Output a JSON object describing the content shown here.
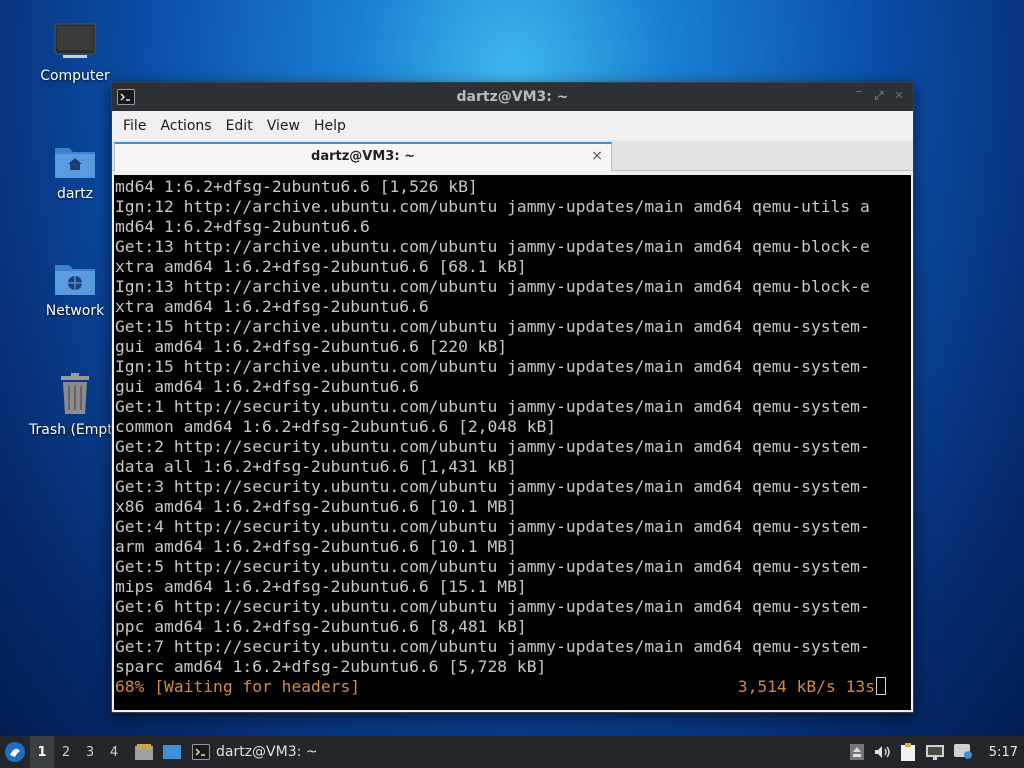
{
  "desktop": {
    "icons": [
      {
        "label": "Computer"
      },
      {
        "label": "dartz"
      },
      {
        "label": "Network"
      },
      {
        "label": "Trash (Empty)"
      }
    ]
  },
  "window": {
    "title": "dartz@VM3: ~",
    "menu": [
      "File",
      "Actions",
      "Edit",
      "View",
      "Help"
    ],
    "tab_label": "dartz@VM3: ~",
    "tab_close": "×"
  },
  "terminal": {
    "lines": [
      "md64 1:6.2+dfsg-2ubuntu6.6 [1,526 kB]",
      "Ign:12 http://archive.ubuntu.com/ubuntu jammy-updates/main amd64 qemu-utils a",
      "md64 1:6.2+dfsg-2ubuntu6.6",
      "Get:13 http://archive.ubuntu.com/ubuntu jammy-updates/main amd64 qemu-block-e",
      "xtra amd64 1:6.2+dfsg-2ubuntu6.6 [68.1 kB]",
      "Ign:13 http://archive.ubuntu.com/ubuntu jammy-updates/main amd64 qemu-block-e",
      "xtra amd64 1:6.2+dfsg-2ubuntu6.6",
      "Get:15 http://archive.ubuntu.com/ubuntu jammy-updates/main amd64 qemu-system-",
      "gui amd64 1:6.2+dfsg-2ubuntu6.6 [220 kB]",
      "Ign:15 http://archive.ubuntu.com/ubuntu jammy-updates/main amd64 qemu-system-",
      "gui amd64 1:6.2+dfsg-2ubuntu6.6",
      "Get:1 http://security.ubuntu.com/ubuntu jammy-updates/main amd64 qemu-system-",
      "common amd64 1:6.2+dfsg-2ubuntu6.6 [2,048 kB]",
      "Get:2 http://security.ubuntu.com/ubuntu jammy-updates/main amd64 qemu-system-",
      "data all 1:6.2+dfsg-2ubuntu6.6 [1,431 kB]",
      "Get:3 http://security.ubuntu.com/ubuntu jammy-updates/main amd64 qemu-system-",
      "x86 amd64 1:6.2+dfsg-2ubuntu6.6 [10.1 MB]",
      "Get:4 http://security.ubuntu.com/ubuntu jammy-updates/main amd64 qemu-system-",
      "arm amd64 1:6.2+dfsg-2ubuntu6.6 [10.1 MB]",
      "Get:5 http://security.ubuntu.com/ubuntu jammy-updates/main amd64 qemu-system-",
      "mips amd64 1:6.2+dfsg-2ubuntu6.6 [15.1 MB]",
      "Get:6 http://security.ubuntu.com/ubuntu jammy-updates/main amd64 qemu-system-",
      "ppc amd64 1:6.2+dfsg-2ubuntu6.6 [8,481 kB]",
      "Get:7 http://security.ubuntu.com/ubuntu jammy-updates/main amd64 qemu-system-",
      "sparc amd64 1:6.2+dfsg-2ubuntu6.6 [5,728 kB]"
    ],
    "status_left": "68% [Waiting for headers]",
    "status_right": "3,514 kB/s 13s"
  },
  "taskbar": {
    "workspaces": [
      "1",
      "2",
      "3",
      "4"
    ],
    "active_workspace": "1",
    "task_label": "dartz@VM3: ~",
    "clock": "5:17"
  },
  "colors": {
    "status_orange": "#d68a3c",
    "terminal_bg": "#000000",
    "terminal_fg": "#c8c8c8",
    "taskbar_bg": "#23272b"
  }
}
